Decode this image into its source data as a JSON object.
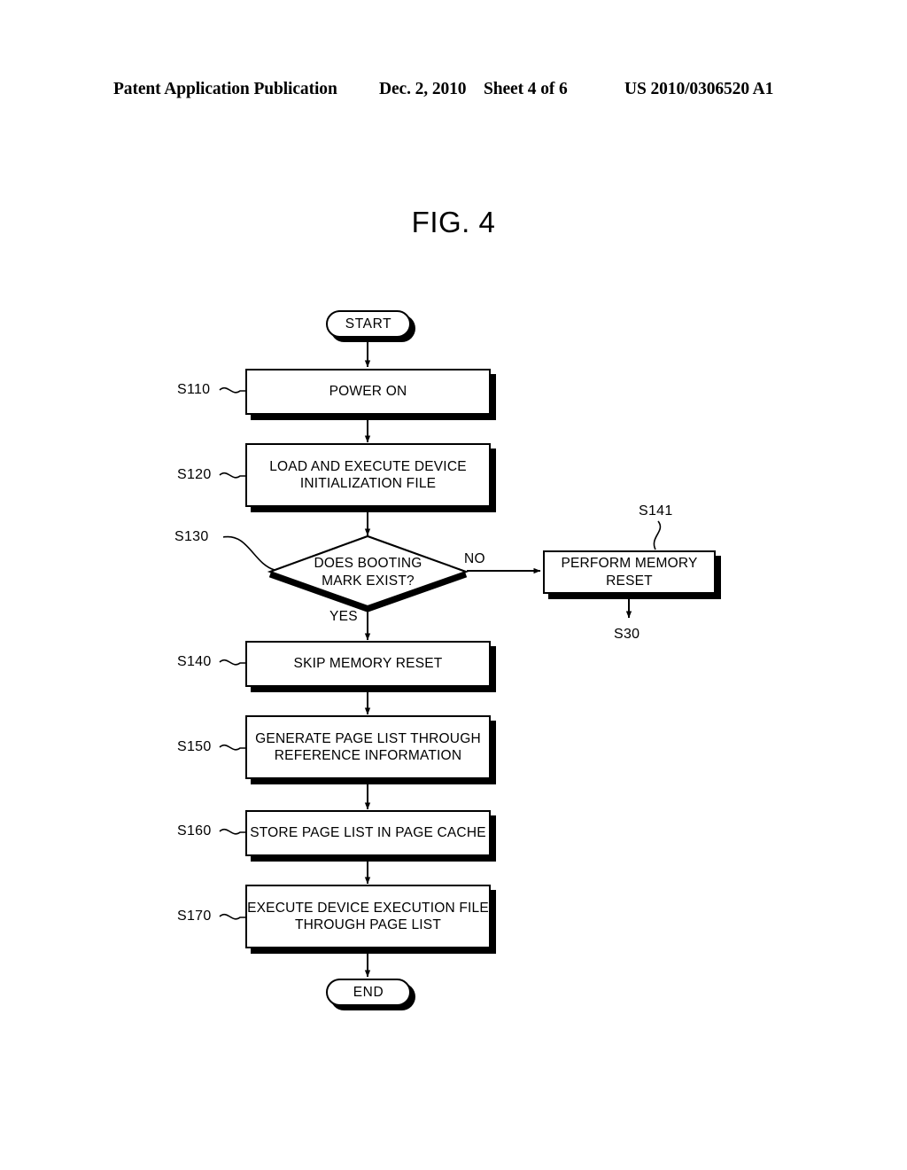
{
  "header": {
    "publication": "Patent Application Publication",
    "date": "Dec. 2, 2010",
    "sheet": "Sheet 4 of 6",
    "document_number": "US 2010/0306520 A1"
  },
  "figure": {
    "title": "FIG. 4"
  },
  "flowchart": {
    "start_label": "START",
    "end_label": "END",
    "branch_yes": "YES",
    "branch_no": "NO",
    "nodes": [
      {
        "ref": "S110",
        "text": "POWER ON"
      },
      {
        "ref": "S120",
        "text": "LOAD AND EXECUTE DEVICE\nINITIALIZATION FILE"
      },
      {
        "ref": "S130",
        "text": "DOES BOOTING\nMARK EXIST?"
      },
      {
        "ref": "S140",
        "text": "SKIP MEMORY RESET"
      },
      {
        "ref": "S150",
        "text": "GENERATE PAGE LIST THROUGH\nREFERENCE INFORMATION"
      },
      {
        "ref": "S160",
        "text": "STORE PAGE LIST IN PAGE CACHE"
      },
      {
        "ref": "S170",
        "text": "EXECUTE DEVICE EXECUTION FILE\nTHROUGH PAGE LIST"
      },
      {
        "ref": "S141",
        "text": "PERFORM MEMORY RESET"
      },
      {
        "ref": "S30",
        "text": ""
      }
    ]
  },
  "colors": {
    "ink": "#000000",
    "paper": "#ffffff"
  }
}
